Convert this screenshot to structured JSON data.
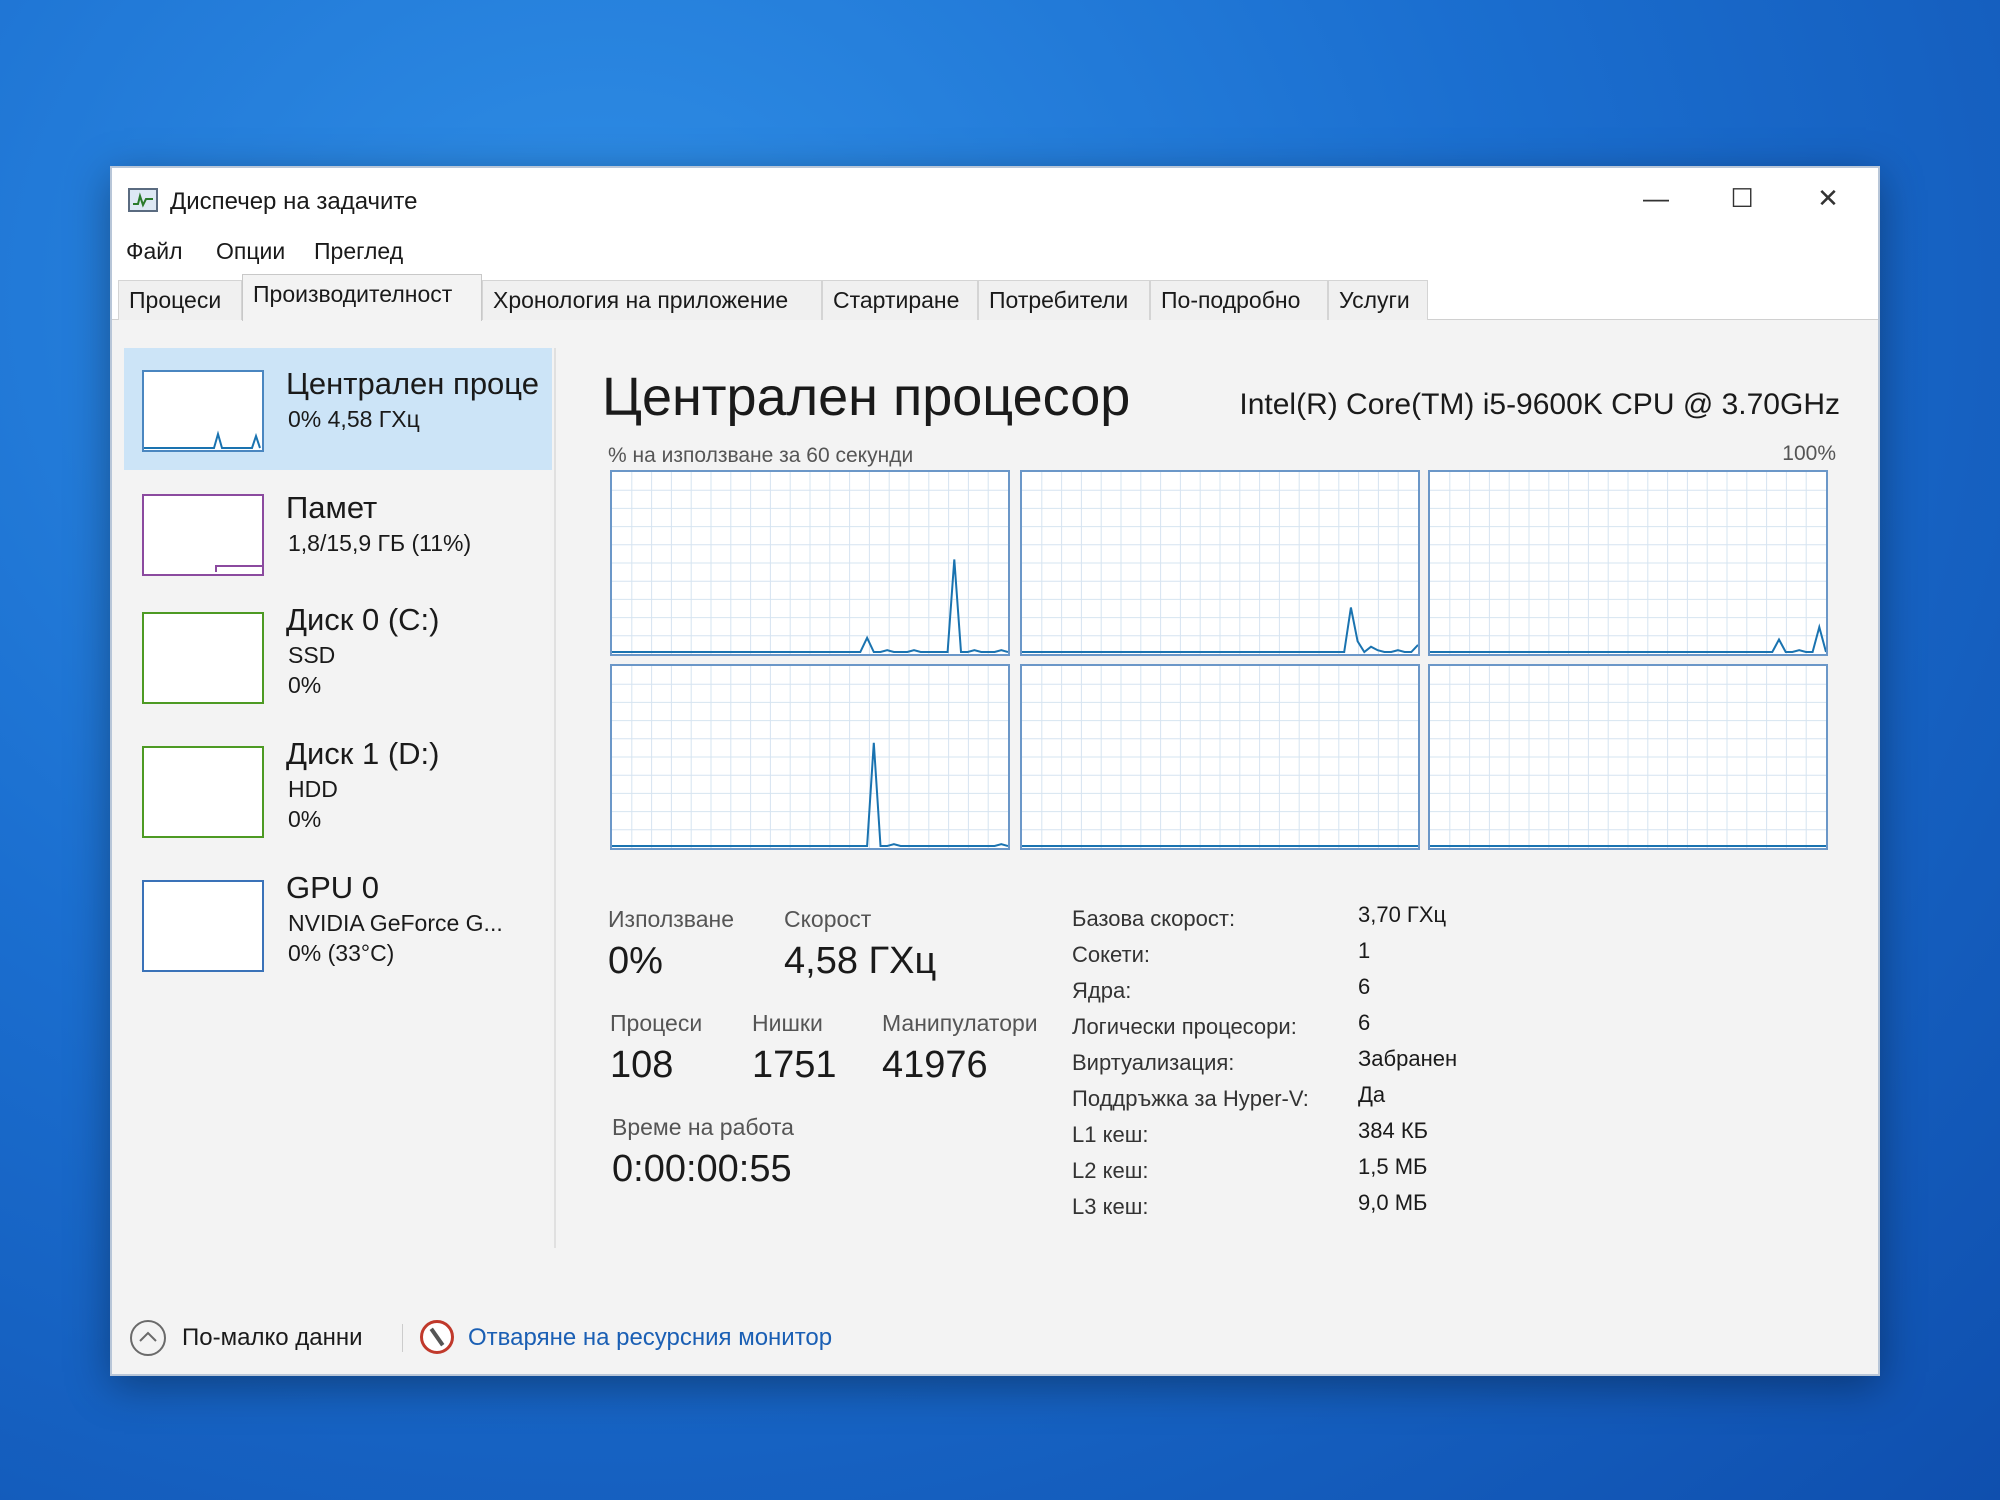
{
  "window": {
    "title": "Диспечер на задачите",
    "controls": {
      "minimize": "—",
      "maximize": "☐",
      "close": "✕"
    }
  },
  "menu": [
    "Файл",
    "Опции",
    "Преглед"
  ],
  "tabs": [
    {
      "label": "Процеси",
      "active": false
    },
    {
      "label": "Производителност",
      "active": true
    },
    {
      "label": "Хронология на приложение",
      "active": false
    },
    {
      "label": "Стартиране",
      "active": false
    },
    {
      "label": "Потребители",
      "active": false
    },
    {
      "label": "По-подробно",
      "active": false
    },
    {
      "label": "Услуги",
      "active": false
    }
  ],
  "sidebar": {
    "items": [
      {
        "name": "Централен проце",
        "line1": "0% 4,58 ГХц",
        "selected": true
      },
      {
        "name": "Памет",
        "line1": "1,8/15,9 ГБ (11%)"
      },
      {
        "name": "Диск 0 (C:)",
        "line1": "SSD",
        "line2": "0%"
      },
      {
        "name": "Диск 1 (D:)",
        "line1": "HDD",
        "line2": "0%"
      },
      {
        "name": "GPU 0",
        "line1": "NVIDIA GeForce G...",
        "line2": "0% (33°C)"
      }
    ]
  },
  "main": {
    "title": "Централен процесор",
    "cpu_model": "Intel(R) Core(TM) i5-9600K CPU @ 3.70GHz",
    "graph_label": "% на използване за 60 секунди",
    "graph_max": "100%"
  },
  "core_graphs": [
    [
      0,
      0,
      0,
      0,
      0,
      0,
      0,
      0,
      0,
      0,
      0,
      0,
      0,
      0,
      0,
      0,
      0,
      0,
      0,
      0,
      0,
      0,
      0,
      0,
      0,
      0,
      0,
      0,
      0,
      0,
      0,
      0,
      0,
      0,
      0,
      0,
      0,
      0,
      8,
      0,
      0,
      1,
      0,
      0,
      0,
      1,
      0,
      0,
      0,
      0,
      0,
      52,
      0,
      0,
      1,
      0,
      0,
      0,
      1,
      0
    ],
    [
      0,
      0,
      0,
      0,
      0,
      0,
      0,
      0,
      0,
      0,
      0,
      0,
      0,
      0,
      0,
      0,
      0,
      0,
      0,
      0,
      0,
      0,
      0,
      0,
      0,
      0,
      0,
      0,
      0,
      0,
      0,
      0,
      0,
      0,
      0,
      0,
      0,
      0,
      0,
      0,
      0,
      0,
      0,
      0,
      0,
      0,
      0,
      0,
      0,
      25,
      6,
      0,
      3,
      1,
      0,
      0,
      1,
      0,
      0,
      4
    ],
    [
      0,
      0,
      0,
      0,
      0,
      0,
      0,
      0,
      0,
      0,
      0,
      0,
      0,
      0,
      0,
      0,
      0,
      0,
      0,
      0,
      0,
      0,
      0,
      0,
      0,
      0,
      0,
      0,
      0,
      0,
      0,
      0,
      0,
      0,
      0,
      0,
      0,
      0,
      0,
      0,
      0,
      0,
      0,
      0,
      0,
      0,
      0,
      0,
      0,
      0,
      0,
      0,
      7,
      0,
      0,
      1,
      0,
      0,
      14,
      0
    ],
    [
      0,
      0,
      0,
      0,
      0,
      0,
      0,
      0,
      0,
      0,
      0,
      0,
      0,
      0,
      0,
      0,
      0,
      0,
      0,
      0,
      0,
      0,
      0,
      0,
      0,
      0,
      0,
      0,
      0,
      0,
      0,
      0,
      0,
      0,
      0,
      0,
      0,
      0,
      0,
      58,
      0,
      0,
      1,
      0,
      0,
      0,
      0,
      0,
      0,
      0,
      0,
      0,
      0,
      0,
      0,
      0,
      0,
      0,
      1,
      0
    ],
    [
      0,
      0,
      0,
      0,
      0,
      0,
      0,
      0,
      0,
      0,
      0,
      0,
      0,
      0,
      0,
      0,
      0,
      0,
      0,
      0,
      0,
      0,
      0,
      0,
      0,
      0,
      0,
      0,
      0,
      0,
      0,
      0,
      0,
      0,
      0,
      0,
      0,
      0,
      0,
      0,
      0,
      0,
      0,
      0,
      0,
      0,
      0,
      0,
      0,
      0,
      0,
      0,
      0,
      0,
      0,
      0,
      0,
      0,
      0,
      0
    ],
    [
      0,
      0,
      0,
      0,
      0,
      0,
      0,
      0,
      0,
      0,
      0,
      0,
      0,
      0,
      0,
      0,
      0,
      0,
      0,
      0,
      0,
      0,
      0,
      0,
      0,
      0,
      0,
      0,
      0,
      0,
      0,
      0,
      0,
      0,
      0,
      0,
      0,
      0,
      0,
      0,
      0,
      0,
      0,
      0,
      0,
      0,
      0,
      0,
      0,
      0,
      0,
      0,
      0,
      0,
      0,
      0,
      0,
      0,
      0,
      0
    ]
  ],
  "stats": {
    "usage_label": "Използване",
    "usage": "0%",
    "speed_label": "Скорост",
    "speed": "4,58 ГХц",
    "processes_label": "Процеси",
    "processes": "108",
    "threads_label": "Нишки",
    "threads": "1751",
    "handles_label": "Манипулатори",
    "handles": "41976",
    "uptime_label": "Време на работа",
    "uptime": "0:00:00:55"
  },
  "info": [
    {
      "key": "Базова скорост:",
      "value": "3,70 ГХц"
    },
    {
      "key": "Сокети:",
      "value": "1"
    },
    {
      "key": "Ядра:",
      "value": "6"
    },
    {
      "key": "Логически процесори:",
      "value": "6"
    },
    {
      "key": "Виртуализация:",
      "value": "Забранен"
    },
    {
      "key": "Поддръжка за Hyper-V:",
      "value": "Да"
    },
    {
      "key": "L1 кеш:",
      "value": "384 КБ"
    },
    {
      "key": "L2 кеш:",
      "value": "1,5 МБ"
    },
    {
      "key": "L3 кеш:",
      "value": "9,0 МБ"
    }
  ],
  "footer": {
    "less_details": "По-малко данни",
    "resource_monitor": "Отваряне на ресурсния монитор"
  },
  "colors": {
    "cpu_line": "#1a73b0",
    "grid": "#d6e4f1",
    "accent": "#cce4f7",
    "link": "#1a5fb4"
  }
}
